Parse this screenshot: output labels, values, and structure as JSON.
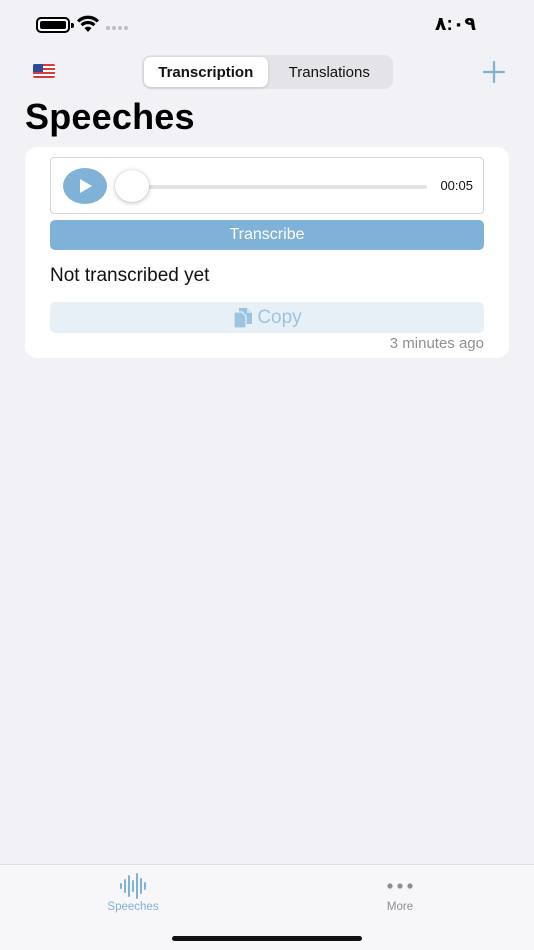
{
  "status_bar": {
    "time": "٨:٠٩",
    "battery_icon": "battery-icon",
    "wifi_icon": "wifi-icon",
    "signal_icon": "cellular-signal-icon"
  },
  "nav": {
    "flag_icon": "us-flag-icon",
    "segments": [
      {
        "label": "Transcription",
        "active": true
      },
      {
        "label": "Translations",
        "active": false
      }
    ],
    "add_icon": "plus-icon"
  },
  "page": {
    "title": "Speeches"
  },
  "speech_card": {
    "player": {
      "play_icon": "play-icon",
      "duration": "00:05",
      "progress": 0.0
    },
    "transcribe_label": "Transcribe",
    "status_text": "Not transcribed yet",
    "copy_label": "Copy",
    "copy_icon": "copy-icon",
    "timestamp": "3 minutes ago"
  },
  "tab_bar": {
    "tabs": [
      {
        "label": "Speeches",
        "icon": "waveform-icon",
        "selected": true
      },
      {
        "label": "More",
        "icon": "ellipsis-icon",
        "selected": false
      }
    ]
  },
  "colors": {
    "accent": "#7fb2d6",
    "background": "#f1f1f6",
    "copy_bg": "#e8f0f7",
    "secondary_text": "#8e8e93"
  }
}
